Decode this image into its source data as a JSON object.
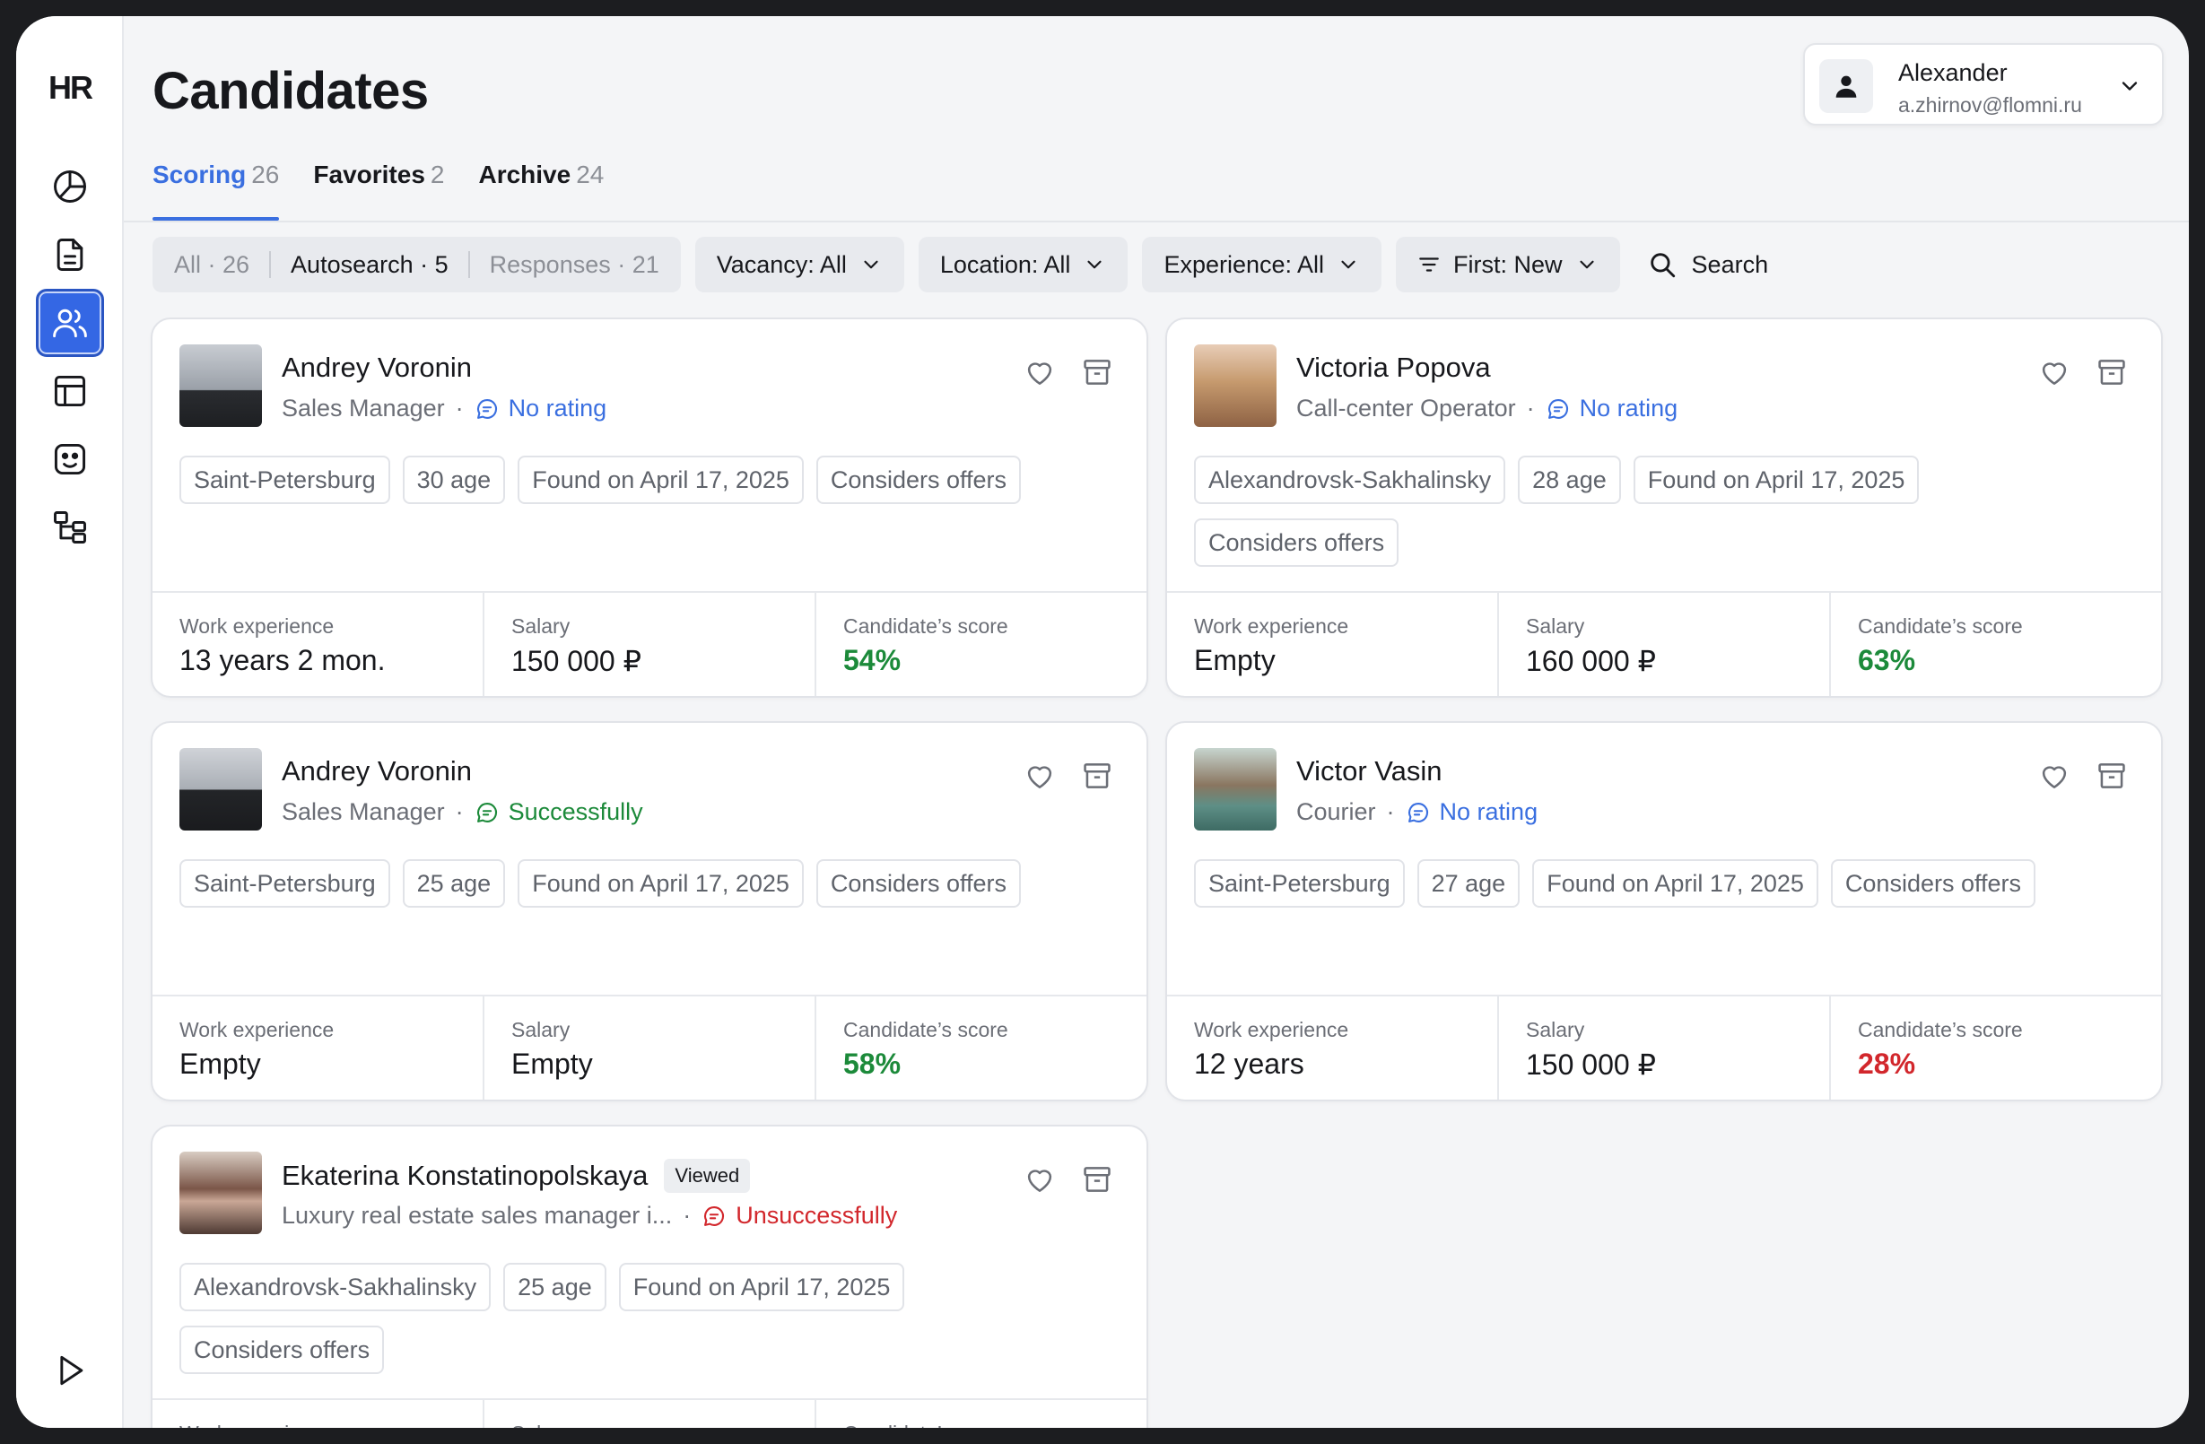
{
  "app": {
    "logo": "HR",
    "title": "Candidates"
  },
  "colors": {
    "accent": "#3a6fe0",
    "good": "#1c8a3a",
    "bad": "#d2272c",
    "neutral_rating": "#3a6fe0"
  },
  "sidebar": {
    "items": [
      {
        "icon": "analytics-icon"
      },
      {
        "icon": "document-icon"
      },
      {
        "icon": "users-icon",
        "active": true
      },
      {
        "icon": "layout-icon"
      },
      {
        "icon": "bot-icon"
      },
      {
        "icon": "org-structure-icon"
      }
    ],
    "bottom_icon": "play-icon"
  },
  "user": {
    "name": "Alexander",
    "email": "a.zhirnov@flomni.ru"
  },
  "tabs": [
    {
      "label": "Scoring",
      "count": "26",
      "active": true
    },
    {
      "label": "Favorites",
      "count": "2"
    },
    {
      "label": "Archive",
      "count": "24"
    }
  ],
  "filters": {
    "segments": [
      {
        "label": "All · 26"
      },
      {
        "label": "Autosearch · 5",
        "selected": true
      },
      {
        "label": "Responses · 21"
      }
    ],
    "vacancy": "Vacancy: All",
    "location": "Location: All",
    "experience": "Experience: All",
    "sort": "First: New",
    "search": "Search"
  },
  "stat_labels": {
    "experience": "Work experience",
    "salary": "Salary",
    "score": "Candidate's score"
  },
  "candidates": [
    {
      "name": "Andrey Voronin",
      "role": "Sales Manager",
      "rating": "No rating",
      "rating_status": "none",
      "city": "Saint-Petersburg",
      "age": "30 age",
      "found": "Found on April 17, 2025",
      "offers": "Considers offers",
      "experience": "13 years 2 mon.",
      "salary": "150 000 ₽",
      "score": "54%",
      "score_status": "good"
    },
    {
      "name": "Victoria Popova",
      "role": "Call-center Operator",
      "rating": "No rating",
      "rating_status": "none",
      "city": "Alexandrovsk-Sakhalinsky",
      "age": "28 age",
      "found": "Found on April 17, 2025",
      "offers": "Considers offers",
      "experience": "Empty",
      "salary": "160 000 ₽",
      "score": "63%",
      "score_status": "good"
    },
    {
      "name": "Andrey Voronin",
      "role": "Sales Manager",
      "rating": "Successfully",
      "rating_status": "success",
      "city": "Saint-Petersburg",
      "age": "25 age",
      "found": "Found on April 17, 2025",
      "offers": "Considers offers",
      "experience": "Empty",
      "salary": "Empty",
      "score": "58%",
      "score_status": "good"
    },
    {
      "name": "Victor Vasin",
      "role": "Courier",
      "rating": "No rating",
      "rating_status": "none",
      "city": "Saint-Petersburg",
      "age": "27 age",
      "found": "Found on April 17, 2025",
      "offers": "Considers offers",
      "experience": "12 years",
      "salary": "150 000 ₽",
      "score": "28%",
      "score_status": "bad"
    },
    {
      "name": "Ekaterina Konstatinopolskaya",
      "badge": "Viewed",
      "role": "Luxury real estate sales manager i...",
      "rating": "Unsuccessfully",
      "rating_status": "fail",
      "city": "Alexandrovsk-Sakhalinsky",
      "age": "25 age",
      "found": "Found on April 17, 2025",
      "offers": "Considers offers",
      "experience": "",
      "salary": "",
      "score": "",
      "score_status": "good"
    }
  ]
}
